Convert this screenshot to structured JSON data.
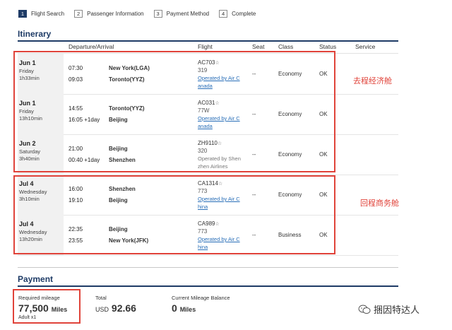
{
  "steps": [
    {
      "num": "1",
      "label": "Flight Search"
    },
    {
      "num": "2",
      "label": "Passenger Information"
    },
    {
      "num": "3",
      "label": "Payment Method"
    },
    {
      "num": "4",
      "label": "Complete"
    }
  ],
  "itinerary": {
    "title": "Itinerary",
    "headers": {
      "departure_arrival": "Departure/Arrival",
      "flight": "Flight",
      "seat": "Seat",
      "class": "Class",
      "status": "Status",
      "service": "Service"
    },
    "rows": [
      {
        "date": "Jun 1",
        "day": "Friday",
        "duration": "1h33min",
        "dep_time": "07:30",
        "arr_time": "09:03",
        "dep_place": "New York(LGA)",
        "arr_place": "Toronto(YYZ)",
        "flight": "AC703",
        "aircraft": "319",
        "operated": "Operated by Air C",
        "operated2": "anada",
        "seat": "--",
        "cls": "Economy",
        "status": "OK"
      },
      {
        "date": "Jun 1",
        "day": "Friday",
        "duration": "13h10min",
        "dep_time": "14:55",
        "arr_time": "16:05 +1day",
        "dep_place": "Toronto(YYZ)",
        "arr_place": "Beijing",
        "flight": "AC031",
        "aircraft": "77W",
        "operated": "Operated by Air C",
        "operated2": "anada",
        "seat": "--",
        "cls": "Economy",
        "status": "OK"
      },
      {
        "date": "Jun 2",
        "day": "Saturday",
        "duration": "3h40min",
        "dep_time": "21:00",
        "arr_time": "00:40 +1day",
        "dep_place": "Beijing",
        "arr_place": "Shenzhen",
        "flight": "ZH9110",
        "aircraft": "320",
        "operated": "Operated by Shen",
        "operated2": "zhen Airlines",
        "seat": "--",
        "cls": "Economy",
        "status": "OK"
      },
      {
        "date": "Jul 4",
        "day": "Wednesday",
        "duration": "3h10min",
        "dep_time": "16:00",
        "arr_time": "19:10",
        "dep_place": "Shenzhen",
        "arr_place": "Beijing",
        "flight": "CA1314",
        "aircraft": "773",
        "operated": "Operated by Air C",
        "operated2": "hina",
        "seat": "--",
        "cls": "Economy",
        "status": "OK"
      },
      {
        "date": "Jul 4",
        "day": "Wednesday",
        "duration": "13h20min",
        "dep_time": "22:35",
        "arr_time": "23:55",
        "dep_place": "Beijing",
        "arr_place": "New York(JFK)",
        "flight": "CA989",
        "aircraft": "773",
        "operated": "Operated by Air C",
        "operated2": "hina",
        "seat": "--",
        "cls": "Business",
        "status": "OK"
      }
    ]
  },
  "notes": {
    "outbound": "去程经济舱",
    "return": "回程商务舱"
  },
  "payment": {
    "title": "Payment",
    "required_label": "Required mileage",
    "required_value": "77,500",
    "required_unit": "Miles",
    "adult": "Adult x1",
    "total_label": "Total",
    "total_currency": "USD",
    "total_value": "92.66",
    "balance_label": "Current Mileage Balance",
    "balance_value": "0",
    "balance_unit": "Miles"
  },
  "watermark": "捆因特达人",
  "colors": {
    "brand": "#1e3b66",
    "link": "#2a6fb8",
    "highlight": "#e0433a"
  }
}
